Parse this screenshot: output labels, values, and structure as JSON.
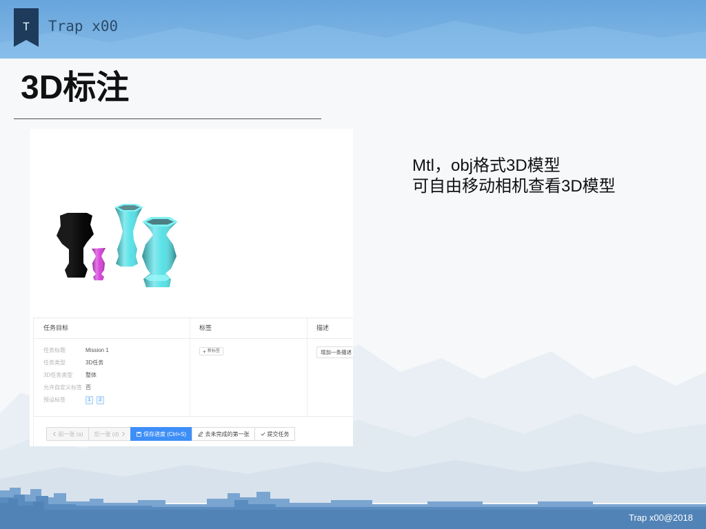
{
  "colors": {
    "banner": "#68a5dc",
    "logo": "#1e3b5c",
    "brand_text": "#2b4a67",
    "accent": "#3e8ef7",
    "tag_bg": "#eaf4fe",
    "footer_band": "#5a8cc0",
    "vase_black": "#060606",
    "vase_magenta": "#d43ad9",
    "vase_cyan": "#4fe0e6"
  },
  "header": {
    "logo_letter": "T",
    "brand": "Trap x00"
  },
  "slide": {
    "title": "3D标注",
    "notes": [
      "Mtl，obj格式3D模型",
      "可自由移动相机查看3D模型"
    ]
  },
  "screenshot": {
    "panel": {
      "task_goal": {
        "title": "任务目标",
        "fields": [
          {
            "label": "任务标题",
            "value": "Mission 1"
          },
          {
            "label": "任务类型",
            "value": "3D任务"
          },
          {
            "label": "3D任务类型",
            "value": "整体"
          },
          {
            "label": "允许自定义标签",
            "value": "否"
          }
        ],
        "preset_tags_label": "预设标签",
        "preset_tags": [
          "1",
          "2"
        ]
      },
      "labels": {
        "title": "标签",
        "new_tag_label": "新标签",
        "new_tag_icon": "plus-icon"
      },
      "description": {
        "title": "描述",
        "add_label": "增加一条描述"
      }
    },
    "toolbar": {
      "prev": {
        "label": "前一张 (a)",
        "icon": "chevron-left-icon",
        "disabled": true
      },
      "next": {
        "label": "后一张 (d)",
        "icon": "chevron-right-icon",
        "disabled": true
      },
      "save": {
        "label": "保存进度 (Ctrl+S)",
        "icon": "save-icon"
      },
      "first_unfinished": {
        "label": "去未完成的第一张",
        "icon": "edit-icon"
      },
      "submit": {
        "label": "提交任务",
        "icon": "check-icon"
      }
    }
  },
  "footer": {
    "copyright": "Trap x00@2018"
  }
}
